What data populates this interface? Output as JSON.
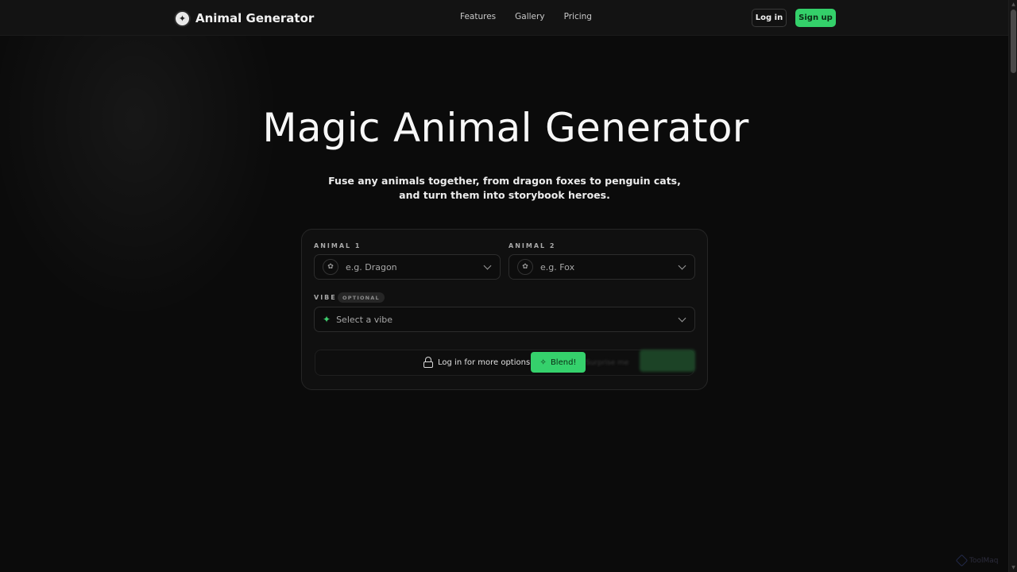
{
  "app": {
    "name": "Animal Generator"
  },
  "nav": {
    "links": [
      "Features",
      "Gallery",
      "Pricing"
    ],
    "login_label": "Log in",
    "signup_label": "Sign up"
  },
  "hero": {
    "title": "Magic Animal Generator",
    "subtitle": "Fuse any animals together, from dragon foxes to penguin cats, and turn them into storybook heroes."
  },
  "form": {
    "animal1": {
      "label": "ANIMAL 1",
      "placeholder": "e.g. Dragon"
    },
    "animal2": {
      "label": "ANIMAL 2",
      "placeholder": "e.g. Fox"
    },
    "vibe": {
      "label": "VIBE",
      "badge": "OPTIONAL",
      "placeholder": "Select a vibe"
    },
    "login_more": "Log in for more options",
    "blend_label": "Blend!",
    "surprise_label": "Surprise me"
  },
  "watermark": {
    "text": "ToolMaq"
  },
  "colors": {
    "accent": "#35d16c",
    "background": "#0b0b0b",
    "card": "#101010"
  },
  "icons": {
    "logo": "animal-logo-icon",
    "animal_select": "paw-icon",
    "vibe": "sparkle-icon",
    "lock": "lock-icon",
    "blend": "sparkle-icon",
    "chevron": "chevron-down-icon"
  }
}
